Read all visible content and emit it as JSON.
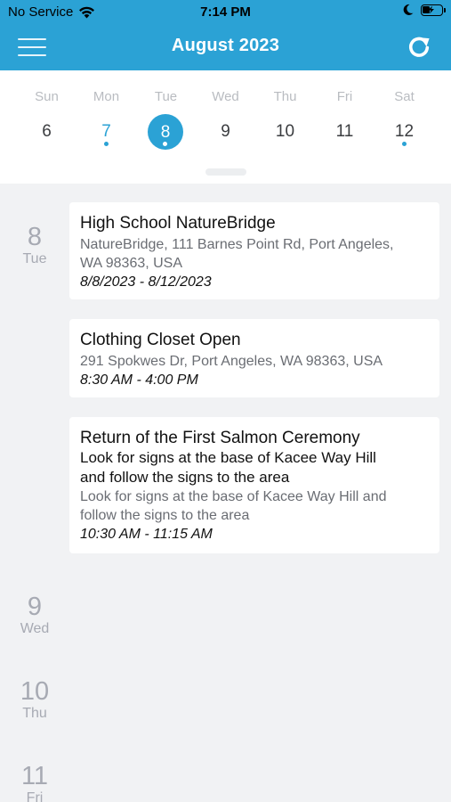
{
  "status_bar": {
    "carrier": "No Service",
    "time": "7:14 PM",
    "icons": [
      "wifi-icon",
      "moon-icon",
      "battery-charging-icon"
    ]
  },
  "nav": {
    "title": "August 2023",
    "left_icon": "menu-icon",
    "right_icon": "refresh-icon",
    "accent_color": "#2ba2d5"
  },
  "week": {
    "days": [
      {
        "dow": "Sun",
        "num": "6"
      },
      {
        "dow": "Mon",
        "num": "7"
      },
      {
        "dow": "Tue",
        "num": "8"
      },
      {
        "dow": "Wed",
        "num": "9"
      },
      {
        "dow": "Thu",
        "num": "10"
      },
      {
        "dow": "Fri",
        "num": "11"
      },
      {
        "dow": "Sat",
        "num": "12"
      }
    ]
  },
  "agenda": {
    "day8": {
      "num": "8",
      "dow": "Tue"
    },
    "day9": {
      "num": "9",
      "dow": "Wed"
    },
    "day10": {
      "num": "10",
      "dow": "Thu"
    },
    "day11": {
      "num": "11",
      "dow": "Fri"
    },
    "events": [
      {
        "title": "High School NatureBridge",
        "address_line1": "NatureBridge, 111 Barnes Point Rd, Port Angeles,",
        "address_line2": "WA 98363, USA",
        "time": "8/8/2023 - 8/12/2023"
      },
      {
        "title": "Clothing Closet Open",
        "address_line1": "291 Spokwes Dr, Port Angeles, WA 98363, USA",
        "time": "8:30 AM - 4:00 PM"
      },
      {
        "title": "Return of the First Salmon Ceremony",
        "subtitle_line1": "Look for signs at the base of Kacee Way Hill",
        "subtitle_line2": "and follow the signs to the area",
        "address_line1": "Look for signs at the base of Kacee Way Hill and",
        "address_line2": "follow the signs to the area",
        "time": "10:30 AM - 11:15 AM"
      }
    ]
  }
}
